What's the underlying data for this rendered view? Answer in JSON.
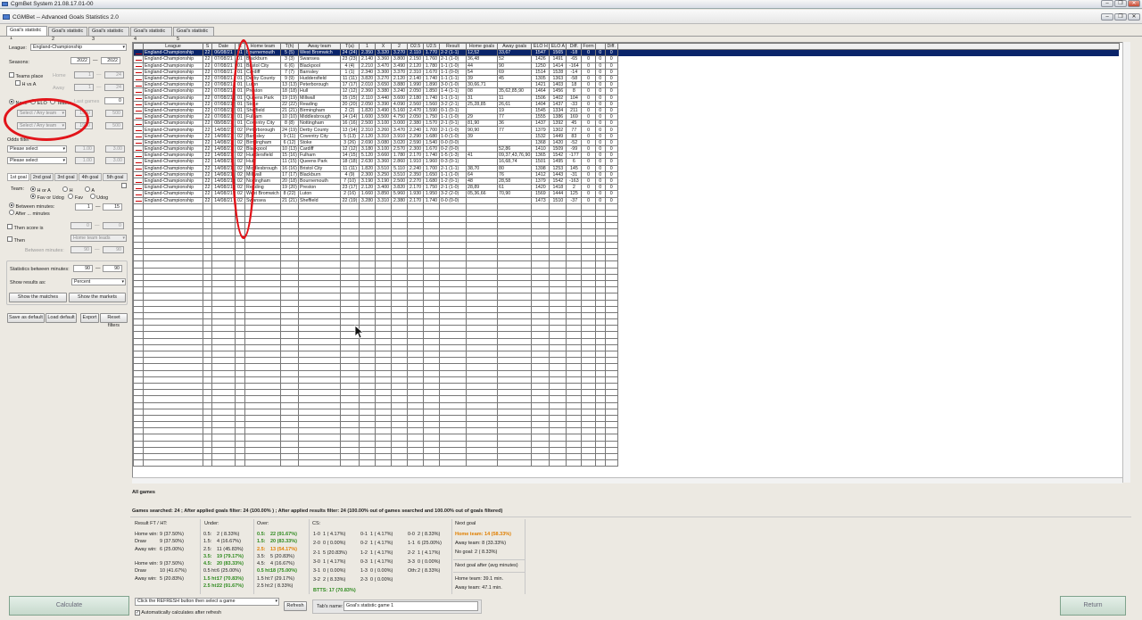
{
  "window": {
    "os_title": "CgmBet System  21.08.17.01-00",
    "app_title": "CGMBet  -- Advanced Goals Statistics 2.0"
  },
  "tabs": [
    "Goal's statistic 1",
    "Goal's statistic 2",
    "Goal's statistic 3",
    "Goal's statistic 4",
    "Goal's statistic 5"
  ],
  "left": {
    "league_label": "League:",
    "league_value": "England-Championship",
    "seasons_label": "Seasons:",
    "season_from": "2022",
    "season_to": "2022",
    "teams_place": "Teams place",
    "home": "Home",
    "away": "Away",
    "hva": "H vs A",
    "home_from": "1",
    "home_to": "24",
    "away_from": "1",
    "away_to": "24",
    "last_games": "Last games",
    "last_games_value": "0",
    "radio_none": "None",
    "radio_elo": "ELO",
    "radio_teams": "Teams",
    "team_select1": "Select / Any team",
    "team_select2": "Select / Any team",
    "val1900": "1900",
    "val500": "500",
    "odds_filter": "Odds filter",
    "please_select": "Please select",
    "odd_from": "1.00",
    "odd_to": "3.00",
    "goal_tabs": [
      "1st goal",
      "2nd goal",
      "3rd goal",
      "4th goal",
      "5th goal"
    ],
    "team_label": "Team:",
    "h_or_a": "H or A",
    "h": "H",
    "a": "A",
    "fav_udog": "Fav or Udog",
    "fav": "Fav",
    "udog": "Udog",
    "between_minutes": "Between minutes:",
    "after_minutes": "After ... minutes",
    "min_from": "1",
    "min_to": "15",
    "then_score": "Then score is",
    "score_from": "0",
    "score_to": "0",
    "then": "Then",
    "then_select": "Home team leads",
    "between_minutes2": "Between minutes:",
    "bm_from": "90",
    "bm_to": "90",
    "stats_between": "Statistics between minutes:",
    "sb_from": "90",
    "sb_to": "90",
    "show_results": "Show results as:",
    "show_results_value": "Percent",
    "show_matches": "Show the matches",
    "show_markets": "Show the markets",
    "save_default": "Save as default",
    "load_default": "Load default",
    "export": "Export",
    "reset": "Reset filters"
  },
  "grid": {
    "columns": [
      "League",
      "S",
      "Date",
      "R",
      "Home team",
      "T(h)",
      "Away team",
      "T(a)",
      "1",
      "X",
      "2",
      "O2.5",
      "U2.5",
      "Result",
      "Home goals",
      "Away goals",
      "ELO H",
      "ELO A",
      "Diff.",
      "Form",
      "",
      "Diff."
    ],
    "rows": [
      [
        "England-Championship",
        "22",
        "06/08/21",
        "01",
        "Bournemouth",
        "5 (5)",
        "West Bromwich",
        "24 (24)",
        "2.350",
        "3.320",
        "3.270",
        "2.110",
        "1.770",
        "2-2 (1-1)",
        "12,52",
        "33,67",
        "1547",
        "1565",
        "-18",
        "0",
        "0",
        "0"
      ],
      [
        "England-Championship",
        "22",
        "07/08/21",
        "01",
        "Blackburn",
        "3 (3)",
        "Swansea",
        "23 (23)",
        "2.140",
        "3.360",
        "3.800",
        "2.150",
        "1.760",
        "2-1 (1-0)",
        "36,48",
        "52",
        "1426",
        "1491",
        "-65",
        "0",
        "0",
        "0"
      ],
      [
        "England-Championship",
        "22",
        "07/08/21",
        "01",
        "Bristol City",
        "6 (6)",
        "Blackpool",
        "4 (4)",
        "2.210",
        "3.470",
        "3.490",
        "2.120",
        "1.780",
        "1-1 (1-0)",
        "44",
        "90",
        "1250",
        "1414",
        "-164",
        "0",
        "0",
        "0"
      ],
      [
        "England-Championship",
        "22",
        "07/08/21",
        "01",
        "Cardiff",
        "7 (7)",
        "Barnsley",
        "1 (1)",
        "2.340",
        "3.300",
        "3.370",
        "2.310",
        "1.670",
        "1-1 (0-0)",
        "54",
        "69",
        "1514",
        "1528",
        "-14",
        "0",
        "0",
        "0"
      ],
      [
        "England-Championship",
        "22",
        "07/08/21",
        "01",
        "Derby County",
        "9 (9)",
        "Huddersfield",
        "11 (11)",
        "3.820",
        "3.270",
        "2.120",
        "2.140",
        "1.740",
        "1-1 (1-1)",
        "39",
        "45",
        "1305",
        "1363",
        "-58",
        "0",
        "0",
        "0"
      ],
      [
        "England-Championship",
        "22",
        "07/08/21",
        "01",
        "Luton",
        "13 (13)",
        "Peterborough",
        "17 (17)",
        "2.010",
        "3.650",
        "3.880",
        "1.990",
        "1.890",
        "3-0 (1-0)",
        "30,66,71",
        "",
        "1421",
        "1403",
        "18",
        "0",
        "0",
        "0"
      ],
      [
        "England-Championship",
        "22",
        "07/08/21",
        "01",
        "Preston",
        "18 (18)",
        "Hull",
        "12 (12)",
        "2.360",
        "3.380",
        "3.240",
        "2.050",
        "1.850",
        "1-4 (1-1)",
        "08",
        "35,62,85,90",
        "1464",
        "1456",
        "8",
        "0",
        "0",
        "0"
      ],
      [
        "England-Championship",
        "22",
        "07/08/21",
        "01",
        "Queens Park",
        "19 (19)",
        "Millwall",
        "15 (15)",
        "2.110",
        "3.440",
        "3.600",
        "2.180",
        "1.740",
        "1-1 (1-1)",
        "31",
        "11",
        "1506",
        "1402",
        "104",
        "0",
        "0",
        "0"
      ],
      [
        "England-Championship",
        "22",
        "07/08/21",
        "01",
        "Stoke",
        "22 (22)",
        "Reading",
        "20 (20)",
        "2.050",
        "3.390",
        "4.090",
        "2.560",
        "1.560",
        "3-2 (2-1)",
        "25,28,85",
        "26,61",
        "1404",
        "1437",
        "-33",
        "0",
        "0",
        "0"
      ],
      [
        "England-Championship",
        "22",
        "07/08/21",
        "01",
        "Sheffield",
        "21 (21)",
        "Birmingham",
        "2 (2)",
        "1.820",
        "3.490",
        "5.160",
        "2.470",
        "1.590",
        "0-1 (0-1)",
        "",
        "19",
        "1545",
        "1334",
        "211",
        "0",
        "0",
        "0"
      ],
      [
        "England-Championship",
        "22",
        "07/08/21",
        "01",
        "Fulham",
        "10 (10)",
        "Middlesbrough",
        "14 (14)",
        "1.600",
        "3.500",
        "4.750",
        "2.050",
        "1.750",
        "1-1 (1-0)",
        "29",
        "77",
        "1555",
        "1386",
        "169",
        "0",
        "0",
        "0"
      ],
      [
        "England-Championship",
        "22",
        "08/08/21",
        "01",
        "Coventry City",
        "8 (8)",
        "Nottingham",
        "16 (16)",
        "2.500",
        "3.100",
        "3.000",
        "2.380",
        "1.570",
        "2-1 (0-1)",
        "81,90",
        "36",
        "1437",
        "1392",
        "45",
        "0",
        "0",
        "0"
      ],
      [
        "England-Championship",
        "22",
        "14/08/21",
        "02",
        "Peterborough",
        "24 (19)",
        "Derby County",
        "13 (14)",
        "2.310",
        "3.260",
        "3.470",
        "2.240",
        "1.700",
        "2-1 (1-0)",
        "90,90",
        "77",
        "1379",
        "1302",
        "77",
        "0",
        "0",
        "0"
      ],
      [
        "England-Championship",
        "22",
        "14/08/21",
        "02",
        "Barnsley",
        "9 (11)",
        "Coventry City",
        "5 (13)",
        "2.120",
        "3.310",
        "3.910",
        "2.290",
        "1.680",
        "1-0 (1-0)",
        "39",
        "",
        "1532",
        "1449",
        "83",
        "0",
        "0",
        "0"
      ],
      [
        "England-Championship",
        "22",
        "14/08/21",
        "02",
        "Birmingham",
        "6 (12)",
        "Stoke",
        "3 (26)",
        "2.690",
        "3.080",
        "3.020",
        "2.590",
        "1.540",
        "0-0 (0-0)",
        "",
        "",
        "1368",
        "1420",
        "-52",
        "0",
        "0",
        "0"
      ],
      [
        "England-Championship",
        "22",
        "14/08/21",
        "02",
        "Blackpool",
        "10 (13)",
        "Cardiff",
        "12 (12)",
        "3.180",
        "3.100",
        "2.570",
        "2.300",
        "1.670",
        "0-2 (0-0)",
        "",
        "52,86",
        "1410",
        "1509",
        "-99",
        "0",
        "0",
        "0"
      ],
      [
        "England-Championship",
        "22",
        "14/08/21",
        "02",
        "Huddersfield",
        "15 (16)",
        "Fulham",
        "14 (15)",
        "5.120",
        "3.660",
        "1.780",
        "2.170",
        "1.740",
        "1-5 (1-3)",
        "41",
        "09,37,43,76,90",
        "1365",
        "1542",
        "-177",
        "0",
        "0",
        "0"
      ],
      [
        "England-Championship",
        "22",
        "14/08/21",
        "02",
        "Hull",
        "11 (15)",
        "Queens Park",
        "18 (18)",
        "2.630",
        "3.360",
        "2.860",
        "1.910",
        "1.960",
        "0-3 (0-1)",
        "",
        "16,68,74",
        "1501",
        "1495",
        "6",
        "0",
        "0",
        "0"
      ],
      [
        "England-Championship",
        "22",
        "14/08/21",
        "02",
        "Middlesbrough",
        "16 (16)",
        "Bristol City",
        "11 (11)",
        "1.820",
        "3.510",
        "5.110",
        "2.240",
        "1.700",
        "2-1 (1-1)",
        "38,70",
        "80",
        "1398",
        "1253",
        "145",
        "0",
        "0",
        "0"
      ],
      [
        "England-Championship",
        "22",
        "14/08/21",
        "02",
        "Millwall",
        "17 (17)",
        "Blackburn",
        "4 (9)",
        "2.300",
        "3.250",
        "3.510",
        "2.350",
        "1.650",
        "1-1 (1-0)",
        "64",
        "76",
        "1412",
        "1443",
        "-31",
        "0",
        "0",
        "0"
      ],
      [
        "England-Championship",
        "22",
        "14/08/21",
        "02",
        "Nottingham",
        "20 (18)",
        "Bournemouth",
        "7 (10)",
        "3.190",
        "3.190",
        "2.500",
        "2.270",
        "1.680",
        "1-2 (0-1)",
        "48",
        "28,58",
        "1379",
        "1542",
        "-163",
        "0",
        "0",
        "0"
      ],
      [
        "England-Championship",
        "22",
        "14/08/21",
        "02",
        "Reading",
        "19 (20)",
        "Preston",
        "23 (17)",
        "2.120",
        "3.400",
        "3.820",
        "2.170",
        "1.750",
        "2-1 (1-0)",
        "28,89",
        "61",
        "1420",
        "1418",
        "2",
        "0",
        "0",
        "0"
      ],
      [
        "England-Championship",
        "22",
        "14/08/21",
        "02",
        "West Bromwich",
        "8 (22)",
        "Luton",
        "2 (16)",
        "1.660",
        "3.850",
        "5.960",
        "1.930",
        "1.950",
        "3-2 (2-0)",
        "05,36,66",
        "70,90",
        "1569",
        "1444",
        "125",
        "0",
        "0",
        "0"
      ],
      [
        "England-Championship",
        "22",
        "14/08/21",
        "02",
        "Swansea",
        "21 (21)",
        "Sheffield",
        "22 (19)",
        "3.280",
        "3.310",
        "2.380",
        "2.170",
        "1.740",
        "0-0 (0-0)",
        "",
        "",
        "1473",
        "1510",
        "-37",
        "0",
        "0",
        "0"
      ]
    ]
  },
  "stats": {
    "all_games": "All games",
    "summary": "Games searched: 24 ;  After applied goals filter: 24 (100.00% ) ;  After applied results filter: 24 (100.00% out of games searched and 100.00% out of goals filtered)",
    "result_hdr": "Result FT / HT:",
    "under_hdr": "Under:",
    "over_hdr": "Over:",
    "cs_hdr": "CS:",
    "next_hdr": "Next goal",
    "res1": [
      [
        "Home win:",
        "9 (37.50%)"
      ],
      [
        "Draw",
        "9 (37.50%)"
      ],
      [
        "Away win:",
        "6 (25.00%)"
      ]
    ],
    "res2": [
      [
        "Home win:",
        "9 (37.50%)"
      ],
      [
        "Draw",
        "10 (41.67%)"
      ],
      [
        "Away win:",
        "5 (20.83%)"
      ]
    ],
    "under": [
      [
        "0.5:",
        "2 ( 8.33%)",
        ""
      ],
      [
        "1.5:",
        "4 (16.67%)",
        ""
      ],
      [
        "2.5:",
        "11 (45.83%)",
        ""
      ],
      [
        "3.5:",
        "19 (79.17%)",
        "g"
      ],
      [
        "4.5:",
        "20 (83.33%)",
        "g"
      ],
      [
        "0.5 ht:",
        "6 (25.00%)",
        ""
      ],
      [
        "1.5 ht:",
        "17 (70.83%)",
        "g"
      ],
      [
        "2.5 ht:",
        "22 (91.67%)",
        "g"
      ]
    ],
    "over": [
      [
        "0.5:",
        "22 (91.67%)",
        "g"
      ],
      [
        "1.5:",
        "20 (83.33%)",
        "g"
      ],
      [
        "2.5:",
        "13 (54.17%)",
        "o"
      ],
      [
        "3.5:",
        "5 (20.83%)",
        ""
      ],
      [
        "4.5:",
        "4 (16.67%)",
        ""
      ],
      [
        "0.5 ht:",
        "18 (75.00%)",
        "g"
      ],
      [
        "1.5 ht:",
        "7 (29.17%)",
        ""
      ],
      [
        "2.5 ht:",
        "2 ( 8.33%)",
        ""
      ]
    ],
    "cs": [
      [
        [
          "1-0",
          "1 ( 4.17%)"
        ],
        [
          "0-1",
          "1 ( 4.17%)"
        ],
        [
          "0-0",
          "2 ( 8.33%)"
        ]
      ],
      [
        [
          "2-0",
          "0 ( 0.00%)"
        ],
        [
          "0-2",
          "1 ( 4.17%)"
        ],
        [
          "1-1",
          "6 (25.00%)"
        ]
      ],
      [
        [
          "2-1",
          "5 (20.83%)"
        ],
        [
          "1-2",
          "1 ( 4.17%)"
        ],
        [
          "2-2",
          "1 ( 4.17%)"
        ]
      ],
      [
        [
          "3-0",
          "1 ( 4.17%)"
        ],
        [
          "0-3",
          "1 ( 4.17%)"
        ],
        [
          "3-3",
          "0 ( 0.00%)"
        ]
      ],
      [
        [
          "3-1",
          "0 ( 0.00%)"
        ],
        [
          "1-3",
          "0 ( 0.00%)"
        ],
        [
          "Oth:",
          "2 ( 8.33%)"
        ]
      ],
      [
        [
          "3-2",
          "2 ( 8.33%)"
        ],
        [
          "2-3",
          "0 ( 0.00%)"
        ],
        [
          "",
          ""
        ]
      ]
    ],
    "btts": "BTTS:   17 (70.83%)",
    "next_home": "Home team:   14 (58.33%)",
    "next_away": "Away team:     8 (33.33%)",
    "next_no": "No goal:    2 ( 8.33%)",
    "next_after": "Next goal after (avg minutes)",
    "home_min": "Home team: 39.1 min.",
    "away_min": "Away team: 47.1 min."
  },
  "bottom": {
    "calculate": "Calculate",
    "refresh_select": "Click the REFRESH button then select a game",
    "refresh": "Refresh",
    "auto_calc": "Automatically calculates after refresh",
    "tab_name_label": "Tab's name:",
    "tab_name_value": "Goal's statistic game 1",
    "return": "Return"
  }
}
